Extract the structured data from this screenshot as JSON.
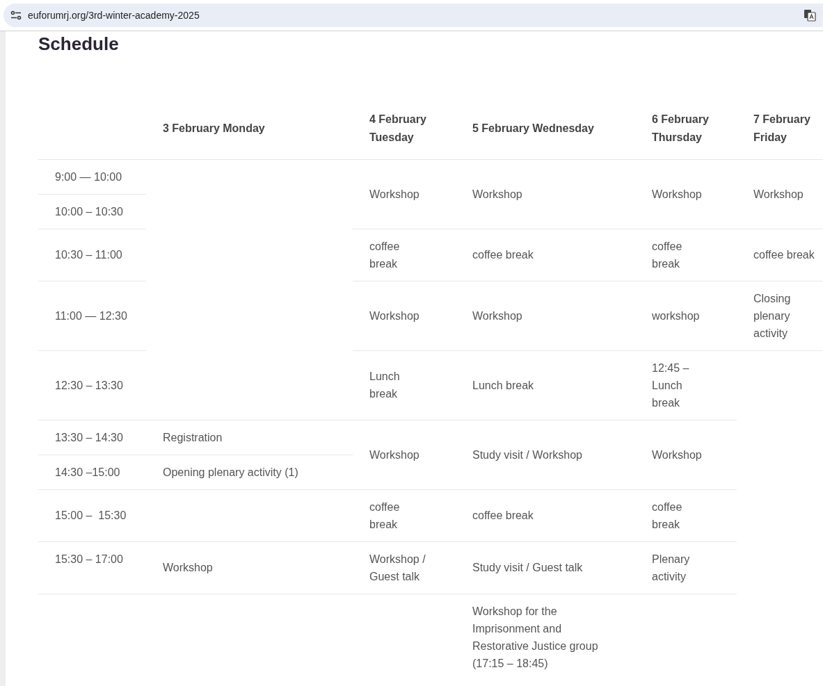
{
  "browser": {
    "url": "euforumrj.org/3rd-winter-academy-2025"
  },
  "page": {
    "title": "Schedule"
  },
  "table": {
    "columns": [
      "",
      "3 February Monday",
      "4 February Tuesday",
      "5 February Wednesday",
      "6 February Thursday",
      "7 February Friday"
    ],
    "rows": [
      {
        "cells": [
          {
            "kind": "text",
            "text": "9:00 — 10:00"
          },
          {
            "kind": "empty",
            "rowspan": 5
          },
          {
            "kind": "text",
            "text": "Workshop",
            "rowspan": 2
          },
          {
            "kind": "text",
            "text": "Workshop",
            "rowspan": 2
          },
          {
            "kind": "text",
            "text": "Workshop",
            "rowspan": 2
          },
          {
            "kind": "text",
            "text": "Workshop",
            "rowspan": 2
          }
        ]
      },
      {
        "cells": [
          {
            "kind": "text",
            "text": "10:00 – 10:30"
          }
        ]
      },
      {
        "cells": [
          {
            "kind": "text",
            "text": "10:30 – 11:00"
          },
          {
            "kind": "text",
            "text": "coffee break"
          },
          {
            "kind": "text",
            "text": "coffee break"
          },
          {
            "kind": "text",
            "text": "coffee break"
          },
          {
            "kind": "text",
            "text": "coffee break"
          }
        ]
      },
      {
        "cells": [
          {
            "kind": "text",
            "text": "11:00 — 12:30"
          },
          {
            "kind": "text",
            "text": "Workshop"
          },
          {
            "kind": "text",
            "text": "Workshop"
          },
          {
            "kind": "text",
            "text": "workshop"
          },
          {
            "kind": "text",
            "text": "Closing plenary activity"
          }
        ]
      },
      {
        "cells": [
          {
            "kind": "text",
            "text": "12:30 – 13:30"
          },
          {
            "kind": "text",
            "text": "Lunch break"
          },
          {
            "kind": "text",
            "text": "Lunch break"
          },
          {
            "kind": "text",
            "text": "12:45 – Lunch break"
          },
          {
            "kind": "empty",
            "rowspan": 6
          }
        ]
      },
      {
        "cells": [
          {
            "kind": "text",
            "text": "13:30 – 14:30"
          },
          {
            "kind": "text",
            "text": "Registration"
          },
          {
            "kind": "text",
            "text": "Workshop",
            "rowspan": 2
          },
          {
            "kind": "text",
            "text": "Study visit / Workshop",
            "rowspan": 2
          },
          {
            "kind": "text",
            "text": "Workshop",
            "rowspan": 2
          }
        ]
      },
      {
        "cells": [
          {
            "kind": "text",
            "text": "14:30 –15:00"
          },
          {
            "kind": "text",
            "text": "Opening plenary activity (1)"
          }
        ]
      },
      {
        "cells": [
          {
            "kind": "text",
            "text": "15:00 –  15:30"
          },
          {
            "kind": "empty"
          },
          {
            "kind": "text",
            "text": "coffee break"
          },
          {
            "kind": "text",
            "text": "coffee break"
          },
          {
            "kind": "text",
            "text": "coffee break"
          }
        ]
      },
      {
        "cells": [
          {
            "kind": "text",
            "text": "15:30 – 17:00"
          },
          {
            "kind": "text",
            "text": "Workshop"
          },
          {
            "kind": "text",
            "text": "Workshop / Guest talk"
          },
          {
            "kind": "text",
            "text": "Study visit / Guest talk"
          },
          {
            "kind": "text",
            "text": "Plenary activity"
          }
        ]
      },
      {
        "cells": [
          {
            "kind": "empty"
          },
          {
            "kind": "empty"
          },
          {
            "kind": "empty"
          },
          {
            "kind": "text",
            "text": "Workshop for the Imprisonment and Restorative Justice group (17:15 – 18:45)"
          },
          {
            "kind": "empty"
          }
        ]
      }
    ]
  }
}
